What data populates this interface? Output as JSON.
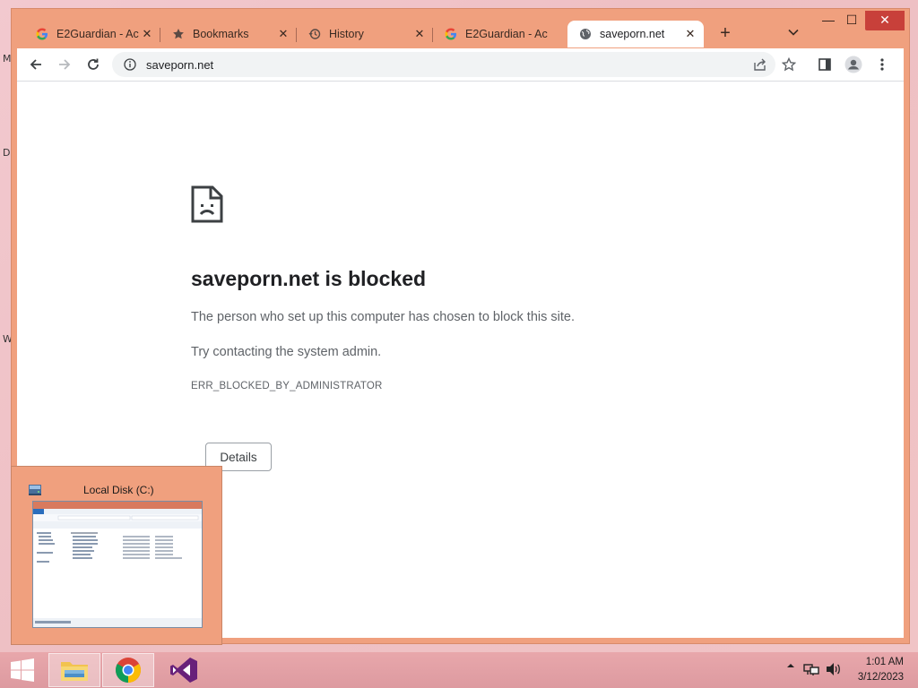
{
  "desktop": {
    "letters": [
      "M",
      "D",
      "W"
    ]
  },
  "window": {
    "controls": {
      "minimize": "—",
      "maximize": "☐",
      "close": "✕"
    }
  },
  "tabs": [
    {
      "title": "E2Guardian - Ac",
      "icon": "google-icon"
    },
    {
      "title": "Bookmarks",
      "icon": "star-icon"
    },
    {
      "title": "History",
      "icon": "history-icon"
    },
    {
      "title": "E2Guardian - Ac",
      "icon": "google-icon"
    },
    {
      "title": "saveporn.net",
      "icon": "globe-icon",
      "active": true
    }
  ],
  "toolbar": {
    "url": "saveporn.net",
    "new_tab": "+",
    "tab_search": "⌄"
  },
  "error_page": {
    "title": "saveporn.net is blocked",
    "description": "The person who set up this computer has chosen to block this site.",
    "hint": "Try contacting the system admin.",
    "code": "ERR_BLOCKED_BY_ADMINISTRATOR",
    "details_label": "Details"
  },
  "thumbnail": {
    "title": "Local Disk (C:)"
  },
  "taskbar": {
    "items": [
      "file-explorer",
      "chrome",
      "visual-studio"
    ],
    "clock_time": "1:01 AM",
    "clock_date": "3/12/2023"
  },
  "colors": {
    "frame": "#f0a07e",
    "close_button": "#c8403a",
    "taskbar": "#e3a0a5",
    "page_bg": "#ffffff"
  }
}
